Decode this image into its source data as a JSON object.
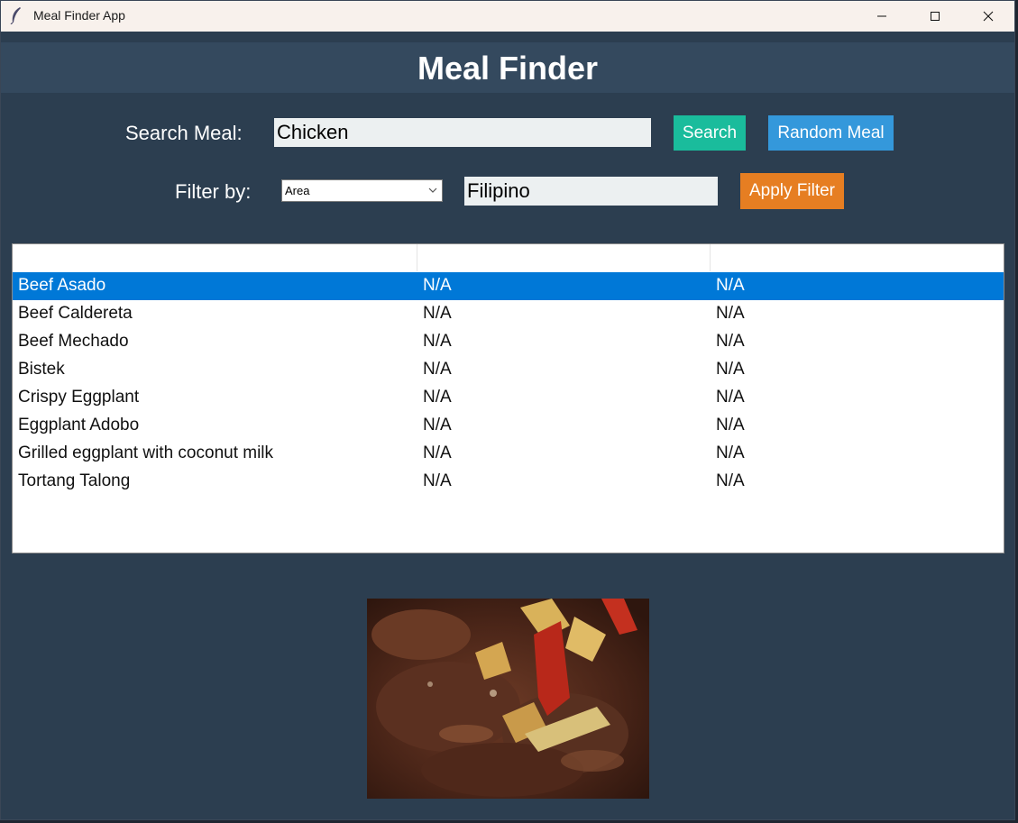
{
  "window": {
    "title": "Meal Finder App"
  },
  "header": {
    "title": "Meal Finder"
  },
  "search": {
    "label": "Search Meal:",
    "value": "Chicken",
    "button": "Search",
    "random_button": "Random Meal"
  },
  "filter": {
    "label": "Filter by:",
    "type_selected": "Area",
    "value": "Filipino",
    "button": "Apply Filter"
  },
  "table": {
    "columns": [
      "",
      "",
      ""
    ],
    "selected_index": 0,
    "rows": [
      {
        "name": "Beef Asado",
        "c2": "N/A",
        "c3": "N/A"
      },
      {
        "name": "Beef Caldereta",
        "c2": "N/A",
        "c3": "N/A"
      },
      {
        "name": "Beef Mechado",
        "c2": "N/A",
        "c3": "N/A"
      },
      {
        "name": "Bistek",
        "c2": "N/A",
        "c3": "N/A"
      },
      {
        "name": "Crispy Eggplant",
        "c2": "N/A",
        "c3": "N/A"
      },
      {
        "name": "Eggplant Adobo",
        "c2": "N/A",
        "c3": "N/A"
      },
      {
        "name": "Grilled eggplant with coconut milk",
        "c2": "N/A",
        "c3": "N/A"
      },
      {
        "name": "Tortang Talong",
        "c2": "N/A",
        "c3": "N/A"
      }
    ]
  },
  "image": {
    "icon": "meal-photo"
  },
  "colors": {
    "background": "#2c3e50",
    "header": "#34495e",
    "search_button": "#1abc9c",
    "random_button": "#3498db",
    "apply_button": "#e67e22",
    "selection": "#0078d7"
  }
}
